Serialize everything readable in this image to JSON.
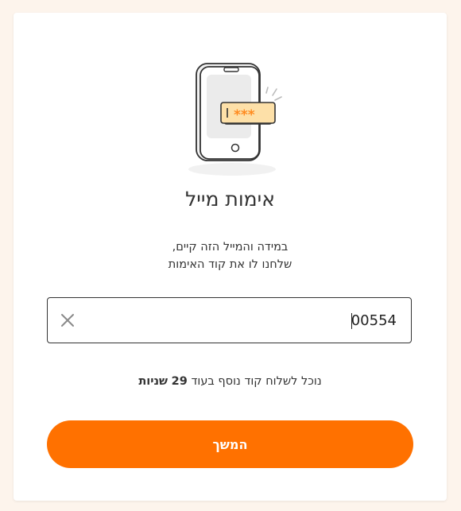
{
  "page": {
    "title": "אימות מייל",
    "subtitle_line1": "במידה והמייל הזה קיים,",
    "subtitle_line2": "שלחנו לו את קוד האימות"
  },
  "code_input": {
    "value": "00554",
    "clear_icon": "close-icon"
  },
  "resend": {
    "prefix": "נוכל לשלוח קוד נוסף בעוד",
    "seconds": "29",
    "unit": "שניות"
  },
  "continue_button": {
    "label": "המשך"
  },
  "illustration": {
    "code_mask": "***",
    "icon": "phone-verification-icon"
  },
  "colors": {
    "accent": "#ff7100",
    "background": "#fdf4ec",
    "code_badge": "#fde0a8"
  }
}
